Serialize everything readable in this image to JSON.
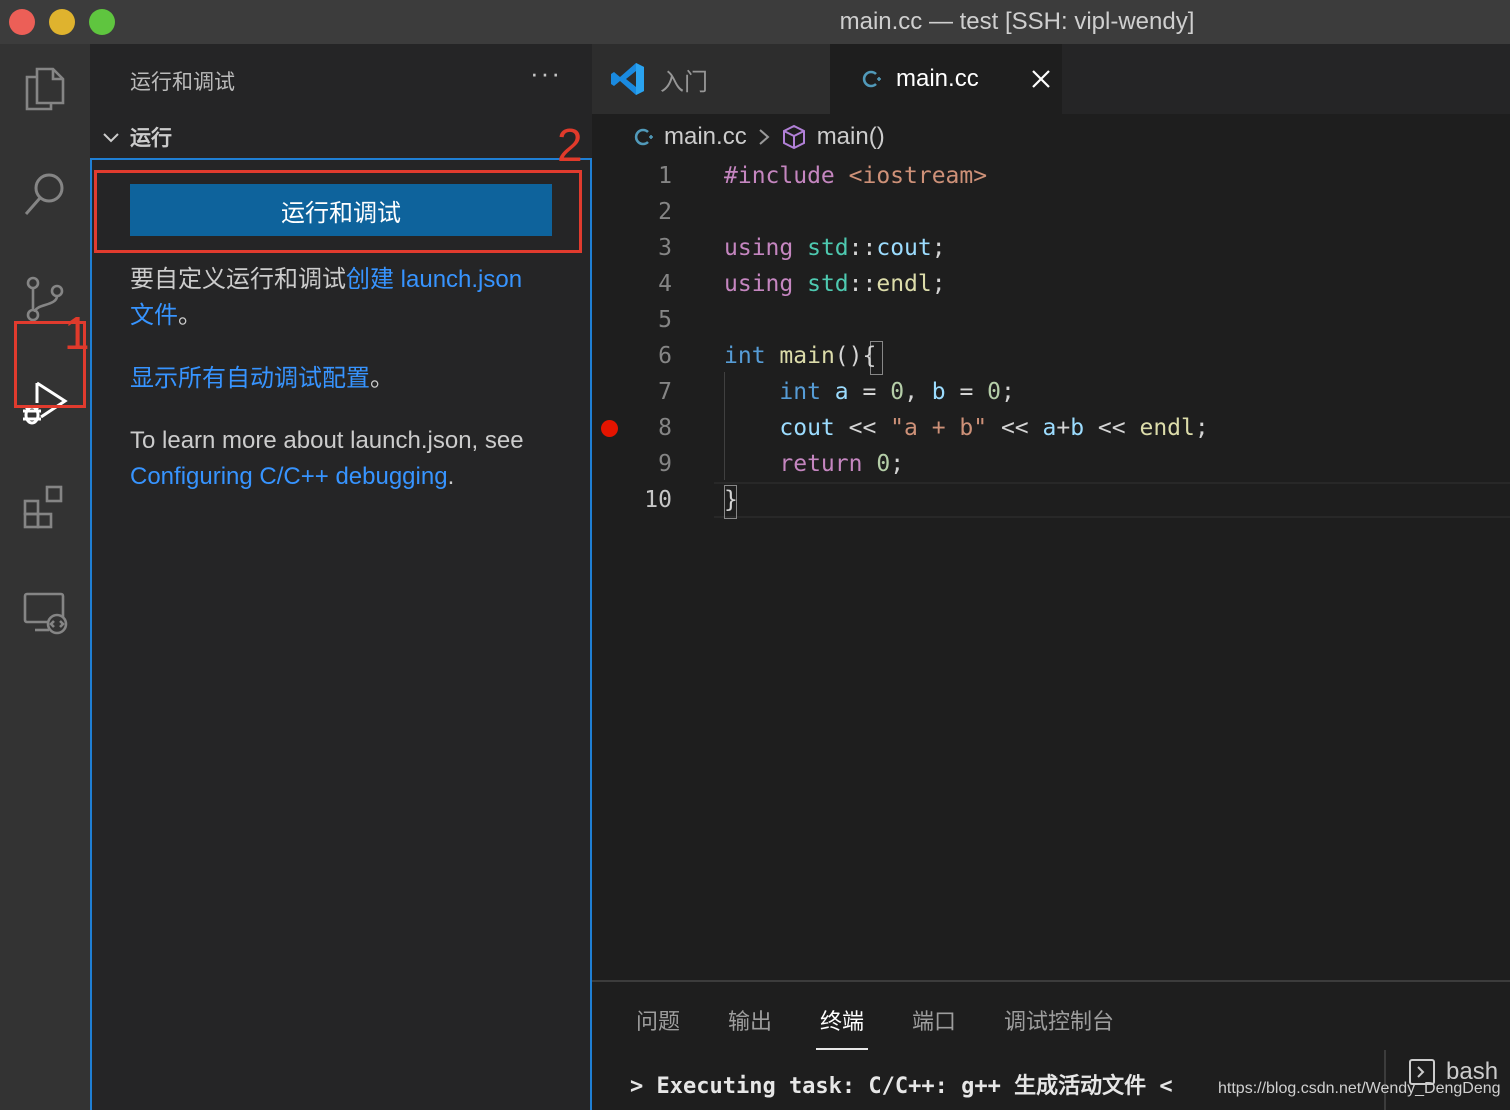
{
  "window": {
    "title": "main.cc — test [SSH: vipl-wendy]"
  },
  "activity_bar": {
    "items": [
      "explorer-icon",
      "search-icon",
      "source-control-icon",
      "run-debug-icon",
      "extensions-icon",
      "remote-explorer-icon"
    ],
    "active": "run-debug-icon"
  },
  "annotations": {
    "step1": "1",
    "step2": "2",
    "highlight_color": "#e13b2e"
  },
  "sidebar": {
    "title": "运行和调试",
    "more": "···",
    "section_label": "运行",
    "run_button_label": "运行和调试",
    "text1_prefix": "要自定义运行和调试",
    "text1_link": "创建 launch.json 文件",
    "text1_suffix": "。",
    "text2_link": "显示所有自动调试配置",
    "text2_suffix": "。",
    "text3_prefix": "To learn more about launch.json, see ",
    "text3_link": "Configuring C/C++ debugging",
    "text3_suffix": "."
  },
  "tabs": {
    "welcome_label": "入门",
    "main_label": "main.cc"
  },
  "breadcrumb": {
    "file": "main.cc",
    "symbol": "main()"
  },
  "editor": {
    "line_numbers": [
      "1",
      "2",
      "3",
      "4",
      "5",
      "6",
      "7",
      "8",
      "9",
      "10"
    ],
    "active_line": 10,
    "breakpoint_line": 8,
    "lines": [
      "#include <iostream>",
      "",
      "using std::cout;",
      "using std::endl;",
      "",
      "int main(){",
      "    int a = 0, b = 0;",
      "    cout << \"a + b\" << a+b << endl;",
      "    return 0;",
      "}"
    ]
  },
  "panel": {
    "tabs": [
      "问题",
      "输出",
      "终端",
      "端口",
      "调试控制台"
    ],
    "active_tab": "终端",
    "terminal_line": "> Executing task: C/C++: g++ 生成活动文件 <",
    "shell_label": "bash"
  },
  "watermark": "https://blog.csdn.net/Wendy_DengDeng",
  "colors": {
    "accent": "#0e639c",
    "link": "#3794ff",
    "breakpoint": "#e51400",
    "focus_border": "#1f7fd4"
  }
}
